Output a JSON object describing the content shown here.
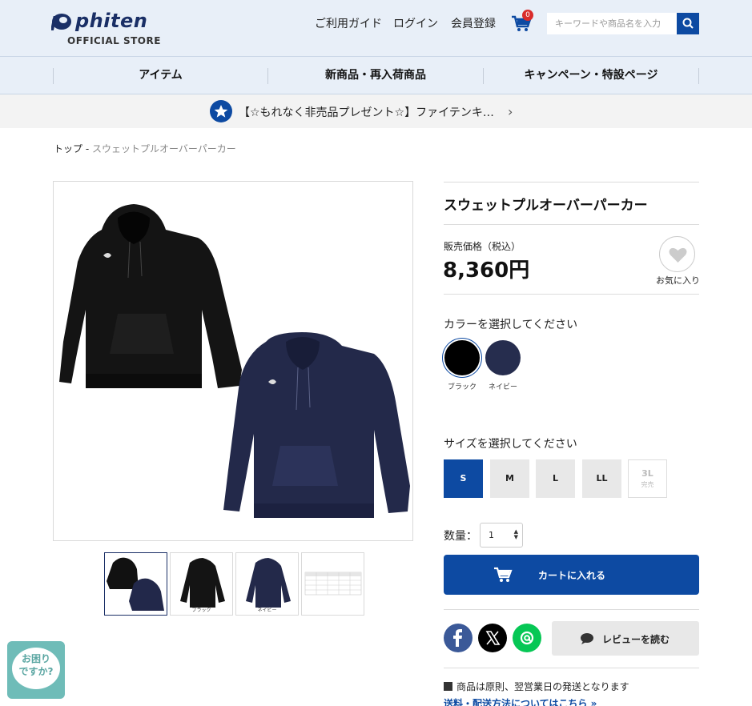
{
  "header": {
    "logo_word": "phiten",
    "logo_sub": "OFFICIAL STORE",
    "nav": [
      "ご利用ガイド",
      "ログイン",
      "会員登録"
    ],
    "cart_count": "0",
    "search_placeholder": "キーワードや商品名を入力"
  },
  "categories": [
    "アイテム",
    "新商品・再入荷商品",
    "キャンペーン・特設ページ"
  ],
  "banner": {
    "text": "【☆もれなく非売品プレゼント☆】ファイテンキ…"
  },
  "breadcrumb": {
    "top": "トップ",
    "sep": " - ",
    "current": "スウェットプルオーバーパーカー"
  },
  "gallery": {
    "thumb_captions": [
      "",
      "ブラック",
      "ネイビー",
      ""
    ]
  },
  "product": {
    "title": "スウェットプルオーバーパーカー",
    "price_label": "販売価格（税込）",
    "price": "8,360円",
    "favorite_label": "お気に入り",
    "color_label": "カラーを選択してください",
    "colors": [
      {
        "name": "ブラック",
        "hex": "#000000"
      },
      {
        "name": "ネイビー",
        "hex": "#262d4e"
      }
    ],
    "size_label": "サイズを選択してください",
    "sizes": [
      {
        "label": "S",
        "state": "selected"
      },
      {
        "label": "M",
        "state": "normal"
      },
      {
        "label": "L",
        "state": "normal"
      },
      {
        "label": "LL",
        "state": "normal"
      },
      {
        "label": "3L",
        "sub": "完売",
        "state": "soldout"
      }
    ],
    "qty_label": "数量：",
    "qty_value": "1",
    "cart_button": "カートに入れる",
    "review_button": "レビューを読む",
    "shipping_note": "商品は原則、翌営業日の発送となります",
    "shipping_link": "送料・配送方法についてはこちら »"
  },
  "help": {
    "line1": "お困り",
    "line2": "ですか?"
  },
  "colors": {
    "brand_blue": "#0d4aa2",
    "header_bg": "#e8eff8",
    "facebook": "#3b5998",
    "x": "#000000",
    "line": "#06c755",
    "help": "#6fbcb8"
  }
}
